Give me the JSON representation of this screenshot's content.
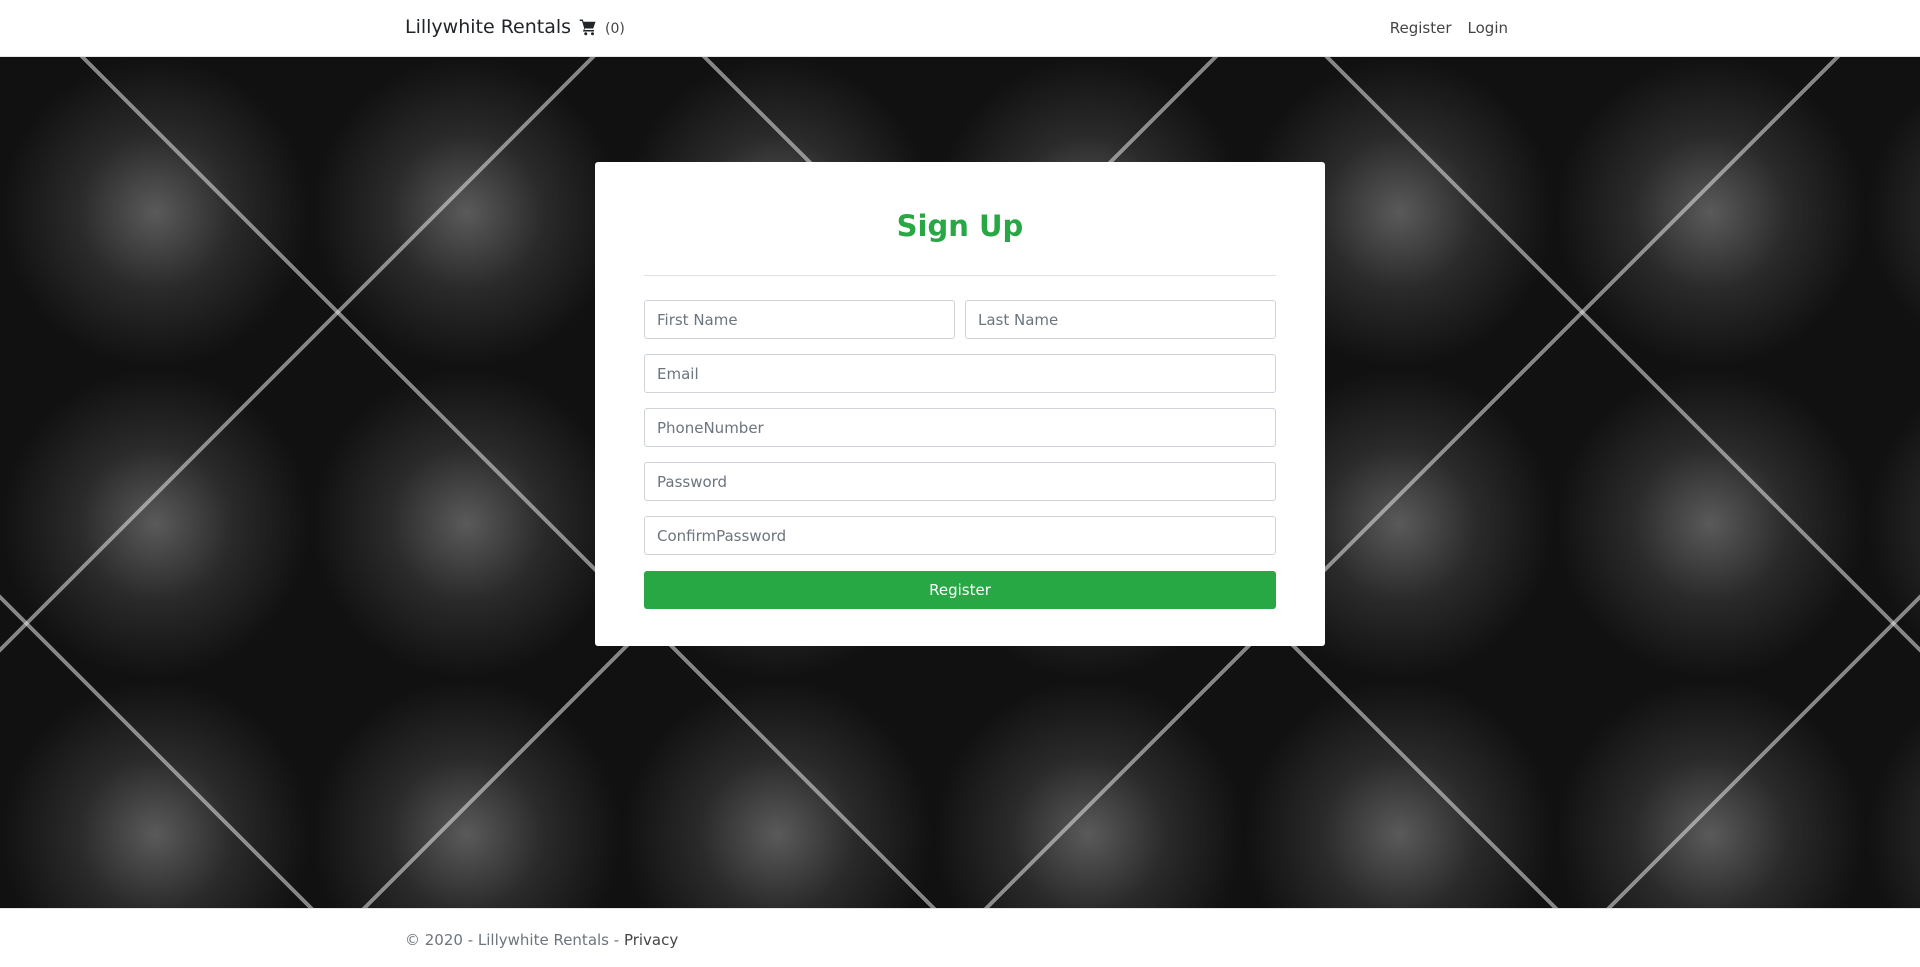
{
  "header": {
    "brand": "Lillywhite Rentals",
    "cart_count": "(0)",
    "nav": {
      "register": "Register",
      "login": "Login"
    }
  },
  "signup": {
    "title": "Sign Up",
    "fields": {
      "first_name": "First Name",
      "last_name": "Last Name",
      "email": "Email",
      "phone": "PhoneNumber",
      "password": "Password",
      "confirm_password": "ConfirmPassword"
    },
    "submit_label": "Register"
  },
  "footer": {
    "copyright": "© 2020 - Lillywhite Rentals - ",
    "privacy": "Privacy"
  },
  "colors": {
    "accent": "#28a745"
  },
  "icons": {
    "cart": "shopping-cart-icon"
  }
}
